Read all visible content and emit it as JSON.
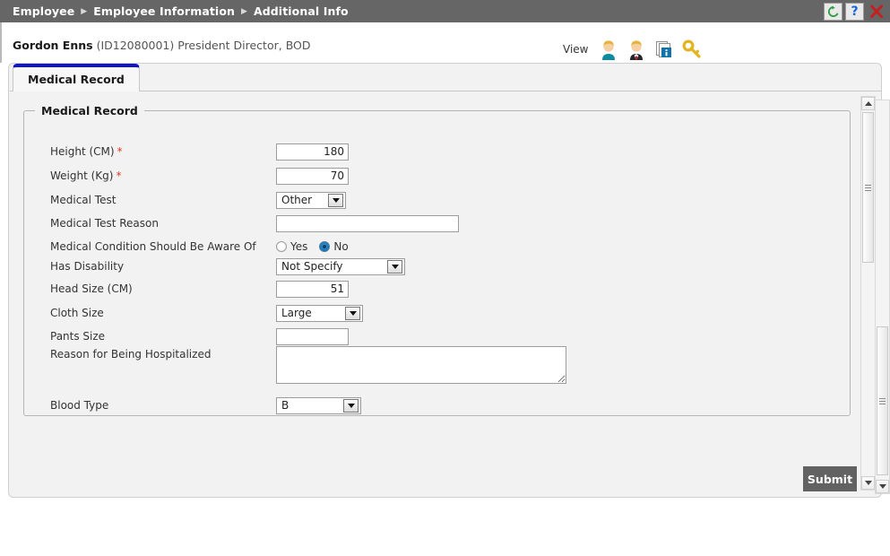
{
  "titlebar": {
    "breadcrumbs": [
      "Employee",
      "Employee Information",
      "Additional Info"
    ],
    "separator": "▶",
    "buttons": [
      {
        "name": "refresh",
        "glyph": "↻",
        "color": "#2e9e3e"
      },
      {
        "name": "help",
        "glyph": "?",
        "color": "#1565d8"
      },
      {
        "name": "close",
        "glyph": "✕",
        "color": "#c32020"
      }
    ],
    "bg_color": "#666666"
  },
  "identity": {
    "name": "Gordon Enns",
    "employee_id": "(ID12080001)",
    "position": "President Director, BOD",
    "view_label": "View",
    "view_icons": [
      "person-casual-icon",
      "person-formal-icon",
      "info-documents-icon",
      "key-icon"
    ]
  },
  "tabs": [
    {
      "label": "Medical Record",
      "active": true
    }
  ],
  "fieldset": {
    "legend": "Medical Record"
  },
  "fields": {
    "height": {
      "label": "Height (CM)",
      "required": true,
      "value": "180"
    },
    "weight": {
      "label": "Weight (Kg)",
      "required": true,
      "value": "70"
    },
    "medical_test": {
      "label": "Medical Test",
      "value": "Other"
    },
    "medical_test_reason": {
      "label": "Medical Test Reason",
      "value": "",
      "placeholder": ""
    },
    "medical_condition": {
      "label": "Medical Condition Should Be Aware Of",
      "options": [
        "Yes",
        "No"
      ],
      "selected": "No"
    },
    "has_disability": {
      "label": "Has Disability",
      "value": "Not Specify"
    },
    "head_size": {
      "label": "Head Size (CM)",
      "value": "51"
    },
    "cloth_size": {
      "label": "Cloth Size",
      "value": "Large"
    },
    "pants_size": {
      "label": "Pants Size",
      "value": "",
      "placeholder": ""
    },
    "hospitalized_reason": {
      "label": "Reason for Being Hospitalized",
      "value": "",
      "placeholder": ""
    },
    "blood_type": {
      "label": "Blood Type",
      "value": "B"
    }
  },
  "actions": {
    "submit_label": "Submit"
  },
  "colors": {
    "header_bg": "#666666",
    "tab_accent": "#1313c8",
    "required_star": "#e23b22",
    "submit_bg": "#626262",
    "panel_bg": "#f2f2f2"
  }
}
